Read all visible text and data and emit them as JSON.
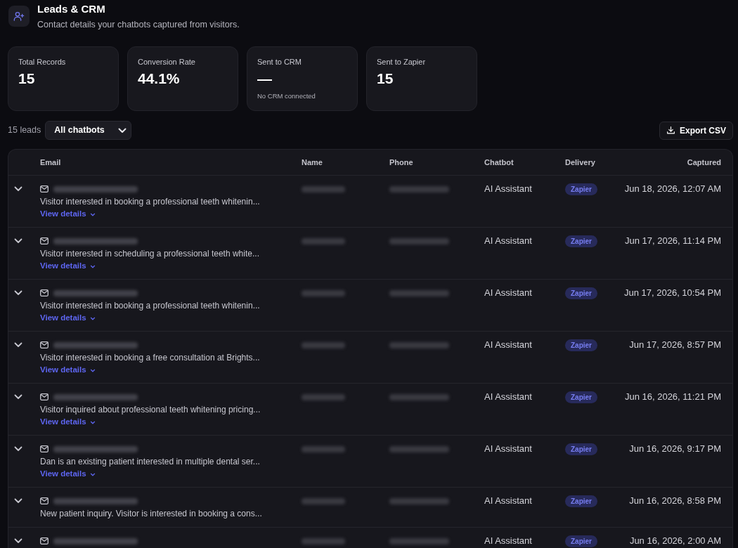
{
  "header": {
    "title": "Leads & CRM",
    "subtitle": "Contact details your chatbots captured from visitors."
  },
  "stats": [
    {
      "label": "Total Records",
      "value": "15"
    },
    {
      "label": "Conversion Rate",
      "value": "44.1%"
    },
    {
      "label": "Sent to CRM",
      "value": "—",
      "note": "No CRM connected"
    },
    {
      "label": "Sent to Zapier",
      "value": "15"
    }
  ],
  "toolbar": {
    "count": "15 leads",
    "filter": {
      "value": "All chatbots"
    },
    "export_button": "Export CSV"
  },
  "table": {
    "columns": [
      "Email",
      "Name",
      "Phone",
      "Chatbot",
      "Delivery",
      "Captured"
    ],
    "rows": [
      {
        "expanded": false,
        "summary": "Visitor interested in booking a professional teeth whitenin...",
        "details_link": "View details",
        "chatbot": "AI Assistant",
        "delivery": "Zapier",
        "captured": "Jun 18, 2026, 12:07 AM"
      },
      {
        "expanded": false,
        "summary": "Visitor interested in scheduling a professional teeth white...",
        "details_link": "View details",
        "chatbot": "AI Assistant",
        "delivery": "Zapier",
        "captured": "Jun 17, 2026, 11:14 PM"
      },
      {
        "expanded": false,
        "summary": "Visitor interested in booking a professional teeth whitenin...",
        "details_link": "View details",
        "chatbot": "AI Assistant",
        "delivery": "Zapier",
        "captured": "Jun 17, 2026, 10:54 PM"
      },
      {
        "expanded": false,
        "summary": "Visitor interested in booking a free consultation at Brights...",
        "details_link": "View details",
        "chatbot": "AI Assistant",
        "delivery": "Zapier",
        "captured": "Jun 17, 2026, 8:57 PM"
      },
      {
        "expanded": false,
        "summary": "Visitor inquired about professional teeth whitening pricing...",
        "details_link": "View details",
        "chatbot": "AI Assistant",
        "delivery": "Zapier",
        "captured": "Jun 16, 2026, 11:21 PM"
      },
      {
        "expanded": false,
        "summary": "Dan is an existing patient interested in multiple dental ser...",
        "details_link": "View details",
        "chatbot": "AI Assistant",
        "delivery": "Zapier",
        "captured": "Jun 16, 2026, 9:17 PM"
      },
      {
        "expanded": false,
        "summary": "New patient inquiry. Visitor is interested in booking a cons...",
        "chatbot": "AI Assistant",
        "delivery": "Zapier",
        "captured": "Jun 16, 2026, 8:58 PM"
      },
      {
        "expanded": false,
        "chatbot": "AI Assistant",
        "delivery": "Zapier",
        "captured": "Jun 16, 2026, 2:00 AM"
      }
    ]
  }
}
